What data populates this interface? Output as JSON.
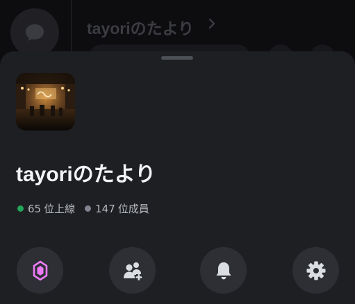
{
  "background": {
    "channel_title": "tayoriのたより"
  },
  "server": {
    "name": "tayoriのたより",
    "online_count": "65",
    "online_label": "位上線",
    "member_count": "147",
    "member_label": "位成員"
  },
  "colors": {
    "online": "#23a55a",
    "offline": "#80848e",
    "boost_icon": "#eb7bf5",
    "icon_default": "#dbdee1"
  },
  "actions": [
    {
      "name": "boost",
      "icon": "boost-gem-icon"
    },
    {
      "name": "invite",
      "icon": "add-member-icon"
    },
    {
      "name": "notifications",
      "icon": "bell-icon"
    },
    {
      "name": "settings",
      "icon": "gear-icon"
    }
  ]
}
